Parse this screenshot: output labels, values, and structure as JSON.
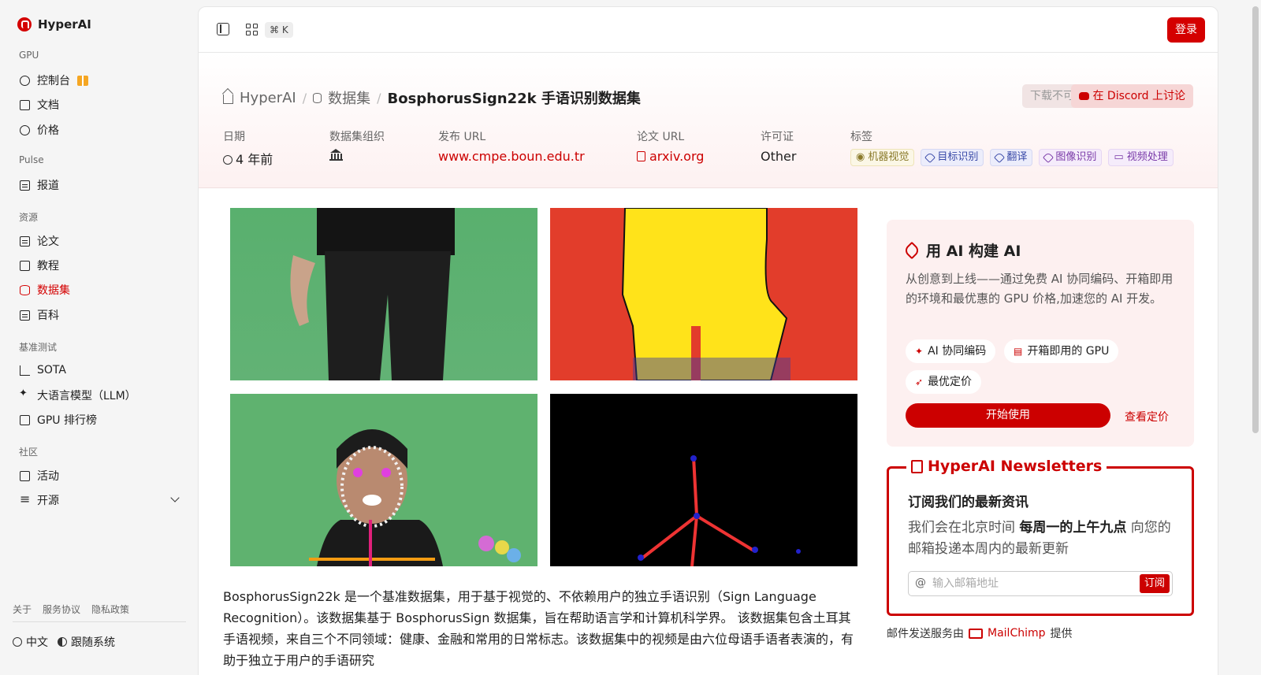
{
  "brand": {
    "name": "HyperAI"
  },
  "sidebar": {
    "sections": [
      {
        "title": "GPU",
        "items": [
          {
            "label": "控制台"
          },
          {
            "label": "文档"
          },
          {
            "label": "价格"
          }
        ]
      },
      {
        "title": "Pulse",
        "items": [
          {
            "label": "报道"
          }
        ]
      },
      {
        "title": "资源",
        "items": [
          {
            "label": "论文"
          },
          {
            "label": "教程"
          },
          {
            "label": "数据集",
            "active": true
          },
          {
            "label": "百科"
          }
        ]
      },
      {
        "title": "基准测试",
        "items": [
          {
            "label": "SOTA"
          },
          {
            "label": "大语言模型（LLM）"
          },
          {
            "label": "GPU 排行榜"
          }
        ]
      },
      {
        "title": "社区",
        "items": [
          {
            "label": "活动"
          },
          {
            "label": "开源"
          }
        ]
      }
    ],
    "footer_links": [
      "关于",
      "服务协议",
      "隐私政策"
    ],
    "language": "中文",
    "theme": "跟随系统"
  },
  "topbar": {
    "shortcut": "⌘ K",
    "login": "登录"
  },
  "breadcrumb": {
    "home": "HyperAI",
    "section": "数据集",
    "current": "BosphorusSign22k 手语识别数据集"
  },
  "actions": {
    "download": "下载不可用",
    "discord": "在 Discord 上讨论"
  },
  "meta": {
    "date_label": "日期",
    "date_value": "4 年前",
    "org_label": "数据集组织",
    "url_label": "发布 URL",
    "url_value": "www.cmpe.boun.edu.tr",
    "paper_label": "论文 URL",
    "paper_value": "arxiv.org",
    "license_label": "许可证",
    "license_value": "Other",
    "tags_label": "标签",
    "tags": [
      "机器视觉",
      "目标识别",
      "翻译",
      "图像识别",
      "视频处理"
    ]
  },
  "description": "BosphorusSign22k 是一个基准数据集，用于基于视觉的、不依赖用户的独立手语识别（Sign Language Recognition）。该数据集基于 BosphorusSign 数据集，旨在帮助语言学和计算机科学界。 该数据集包含土耳其手语视频，来自三个不同领域：健康、金融和常用的日常标志。该数据集中的视频是由六位母语手语者表演的，有助于独立于用户的手语研究",
  "ai_card": {
    "title": "用 AI 构建 AI",
    "body": "从创意到上线——通过免费 AI 协同编码、开箱即用的环境和最优惠的 GPU 价格,加速您的 AI 开发。",
    "chips": [
      "AI 协同编码",
      "开箱即用的 GPU",
      "最优定价"
    ],
    "start": "开始使用",
    "pricing": "查看定价"
  },
  "newsletter": {
    "title": "HyperAI Newsletters",
    "heading": "订阅我们的最新资讯",
    "body_pre": "我们会在北京时间 ",
    "body_bold": "每周一的上午九点",
    "body_post": " 向您的邮箱投递本周内的最新更新",
    "placeholder": "输入邮箱地址",
    "subscribe": "订阅",
    "credit_pre": "邮件发送服务由",
    "credit_brand": "MailChimp",
    "credit_post": "提供"
  },
  "colors": {
    "accent": "#d40000",
    "tag_yellow": "#8a7a2a",
    "tag_blue": "#3a4aa8",
    "tag_purple": "#7a3aa8"
  }
}
